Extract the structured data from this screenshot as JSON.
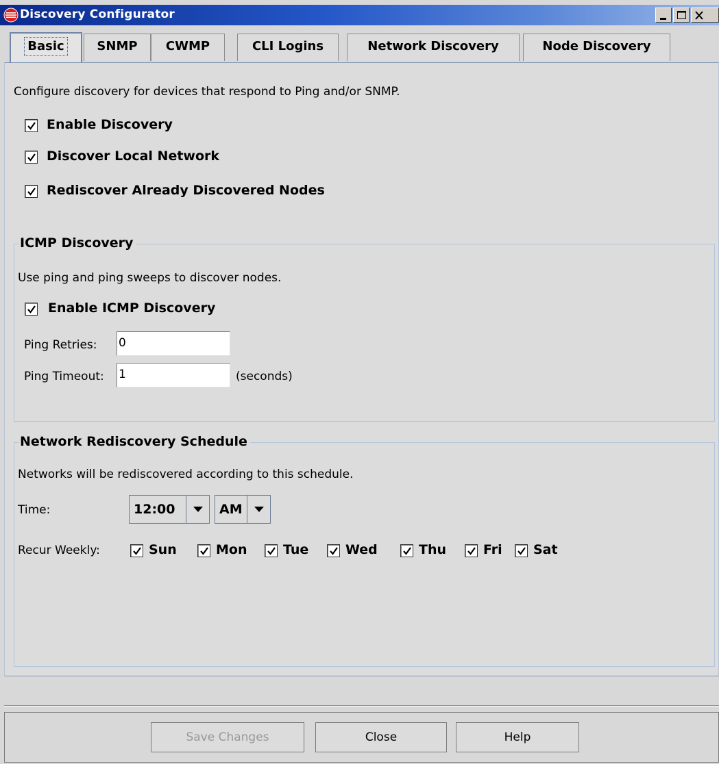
{
  "window": {
    "title": "Discovery Configurator",
    "icon": "app-logo-icon"
  },
  "tabs": [
    {
      "label": "Basic",
      "active": true
    },
    {
      "label": "SNMP"
    },
    {
      "label": "CWMP"
    },
    {
      "label": "CLI Logins"
    },
    {
      "label": "Network Discovery"
    },
    {
      "label": "Node Discovery"
    }
  ],
  "basic": {
    "description": "Configure discovery for devices that respond to Ping and/or SNMP.",
    "enable_discovery": {
      "label": "Enable Discovery",
      "checked": true
    },
    "discover_local": {
      "label": "Discover Local Network",
      "checked": true
    },
    "rediscover": {
      "label": "Rediscover Already Discovered Nodes",
      "checked": true
    }
  },
  "icmp": {
    "title": "ICMP Discovery",
    "description": "Use ping and ping sweeps to discover nodes.",
    "enable": {
      "label": "Enable ICMP Discovery",
      "checked": true
    },
    "retries_label": "Ping Retries:",
    "retries_value": "0",
    "timeout_label": "Ping Timeout:",
    "timeout_value": "1",
    "timeout_unit": "(seconds)"
  },
  "schedule": {
    "title": "Network Rediscovery Schedule",
    "description": "Networks will be rediscovered according to this schedule.",
    "time_label": "Time:",
    "time_value": "12:00",
    "ampm_value": "AM",
    "recur_label": "Recur Weekly:",
    "days": [
      {
        "label": "Sun",
        "checked": true
      },
      {
        "label": "Mon",
        "checked": true
      },
      {
        "label": "Tue",
        "checked": true
      },
      {
        "label": "Wed",
        "checked": true
      },
      {
        "label": "Thu",
        "checked": true
      },
      {
        "label": "Fri",
        "checked": true
      },
      {
        "label": "Sat",
        "checked": true
      }
    ]
  },
  "buttons": {
    "save": "Save Changes",
    "close": "Close",
    "help": "Help"
  }
}
